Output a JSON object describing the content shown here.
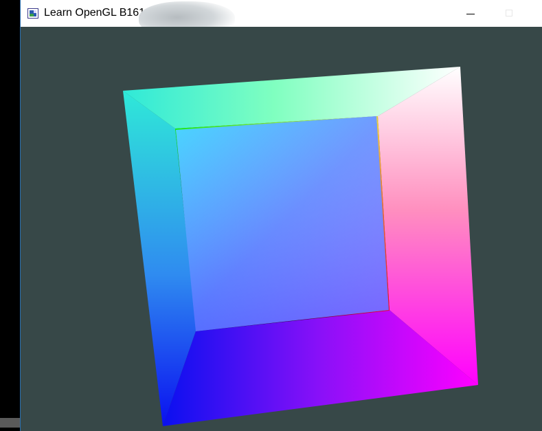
{
  "window": {
    "title": "Learn OpenGL B161",
    "icon": "opengl-app-icon",
    "controls": [
      "minimize-icon",
      "maximize-icon"
    ]
  },
  "viewport": {
    "clear_color": "#374848"
  },
  "colors": {
    "cube_top_left": "#2fe9d8",
    "cube_top_right": "#ffffff",
    "cube_bottom_left": "#0a10f0",
    "cube_bottom_right": "#ff00ff",
    "inner_top_left": "#2fd2ff",
    "inner_bottom_right": "#8d76ff",
    "back_dark": "#0a0220",
    "green": "#17ff17",
    "red": "#ff0018",
    "yellow": "#ffe940"
  }
}
